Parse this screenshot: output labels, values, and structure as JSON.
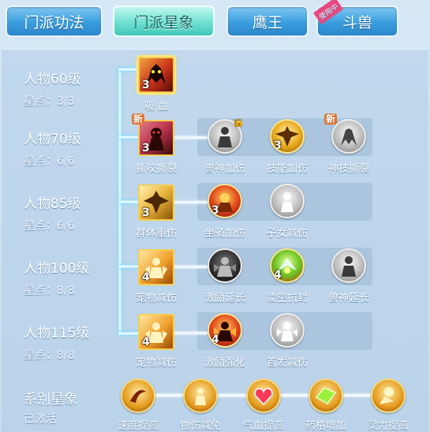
{
  "tabs": [
    {
      "label": "门派功法",
      "state": "inactive"
    },
    {
      "label": "门派星象",
      "state": "active"
    },
    {
      "label": "鹰王",
      "state": "inactive"
    },
    {
      "label": "斗兽",
      "state": "inactive",
      "badge": "使用中"
    }
  ],
  "tiers": [
    {
      "name": "人物60级",
      "points": "星点：3/3"
    },
    {
      "name": "人物70级",
      "points": "星点：6/6"
    },
    {
      "name": "人物85级",
      "points": "星点：6/6"
    },
    {
      "name": "人物100级",
      "points": "星点：8/8"
    },
    {
      "name": "人物115级",
      "points": "星点：8/8"
    }
  ],
  "skills": {
    "r60": [
      {
        "name": "吸 血",
        "level": "3",
        "icon": "blood-drain-icon"
      }
    ],
    "r70": [
      {
        "name": "撕咬撕裂",
        "level": "3",
        "icon": "bite-icon",
        "new": "新"
      },
      {
        "name": "兽神加伤",
        "level": "",
        "icon": "beast-god-icon"
      },
      {
        "name": "技能加伤",
        "level": "3",
        "icon": "eagle-icon"
      },
      {
        "name": "神技撕裂",
        "level": "",
        "icon": "claw-icon",
        "new": "新"
      }
    ],
    "r85": [
      {
        "name": "群体重伤",
        "level": "3",
        "icon": "eagle-swarm-icon"
      },
      {
        "name": "坐骑加伤",
        "level": "3",
        "icon": "mount-icon"
      },
      {
        "name": "子女减伤",
        "level": "",
        "icon": "child-icon"
      }
    ],
    "r100": [
      {
        "name": "宠物减伤",
        "level": "4",
        "icon": "pet-shield-icon"
      },
      {
        "name": "激励延长",
        "level": "",
        "icon": "inspire-icon"
      },
      {
        "name": "凌空抗封",
        "level": "4",
        "icon": "soar-icon"
      },
      {
        "name": "兽神延长",
        "level": "",
        "icon": "beast-extend-icon"
      }
    ],
    "r115": [
      {
        "name": "宠物减伤",
        "level": "4",
        "icon": "pet-shield-icon"
      },
      {
        "name": "激励强化",
        "level": "4",
        "icon": "inspire-boost-icon"
      },
      {
        "name": "首发减伤",
        "level": "",
        "icon": "first-strike-icon"
      }
    ]
  },
  "constellation": {
    "title": "系别星象",
    "status": "已激活",
    "items": [
      {
        "name": "速度提高",
        "icon": "speed-icon"
      },
      {
        "name": "物伤减免",
        "icon": "phys-reduce-icon"
      },
      {
        "name": "气血提高",
        "icon": "hp-icon"
      },
      {
        "name": "药格增加",
        "icon": "potion-icon"
      },
      {
        "name": "灵力提高",
        "icon": "spirit-icon"
      }
    ]
  }
}
